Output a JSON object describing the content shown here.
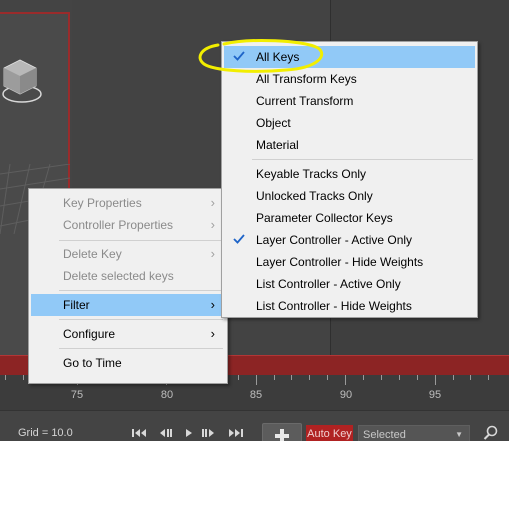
{
  "left_menu": {
    "items": [
      {
        "label": "Key Properties",
        "disabled": true,
        "submenu": true
      },
      {
        "label": "Controller Properties",
        "disabled": true,
        "submenu": true
      },
      {
        "label": "Delete Key",
        "disabled": true,
        "submenu": true
      },
      {
        "label": "Delete selected keys",
        "disabled": true,
        "submenu": false
      },
      {
        "label": "Filter",
        "disabled": false,
        "submenu": true,
        "highlighted": true
      },
      {
        "label": "Configure",
        "disabled": false,
        "submenu": true
      },
      {
        "label": "Go to Time",
        "disabled": false,
        "submenu": false
      }
    ]
  },
  "filter_menu": {
    "items": [
      {
        "label": "All Keys",
        "checked": true,
        "highlighted": true
      },
      {
        "label": "All Transform Keys",
        "checked": false
      },
      {
        "label": "Current Transform",
        "checked": false
      },
      {
        "label": "Object",
        "checked": false
      },
      {
        "label": "Material",
        "checked": false
      },
      {
        "label": "Keyable Tracks Only",
        "checked": false
      },
      {
        "label": "Unlocked Tracks Only",
        "checked": false
      },
      {
        "label": "Parameter Collector Keys",
        "checked": false
      },
      {
        "label": "Layer Controller - Active Only",
        "checked": true
      },
      {
        "label": "Layer Controller - Hide Weights",
        "checked": false
      },
      {
        "label": "List Controller - Active Only",
        "checked": false
      },
      {
        "label": "List Controller - Hide Weights",
        "checked": false
      }
    ]
  },
  "timeline": {
    "labels": [
      "75",
      "80",
      "85",
      "90",
      "95"
    ]
  },
  "status_bar": {
    "grid": "Grid = 10.0",
    "auto_key": "Auto Key",
    "selection_set": "Selected"
  },
  "colors": {
    "menu_highlight": "#91c9f7",
    "check": "#1e64c8",
    "auto_key": "#b02222",
    "annotation": "#f2ee00"
  },
  "icons": {
    "submenu_arrow": "›",
    "dropdown_arrow": "▼"
  }
}
